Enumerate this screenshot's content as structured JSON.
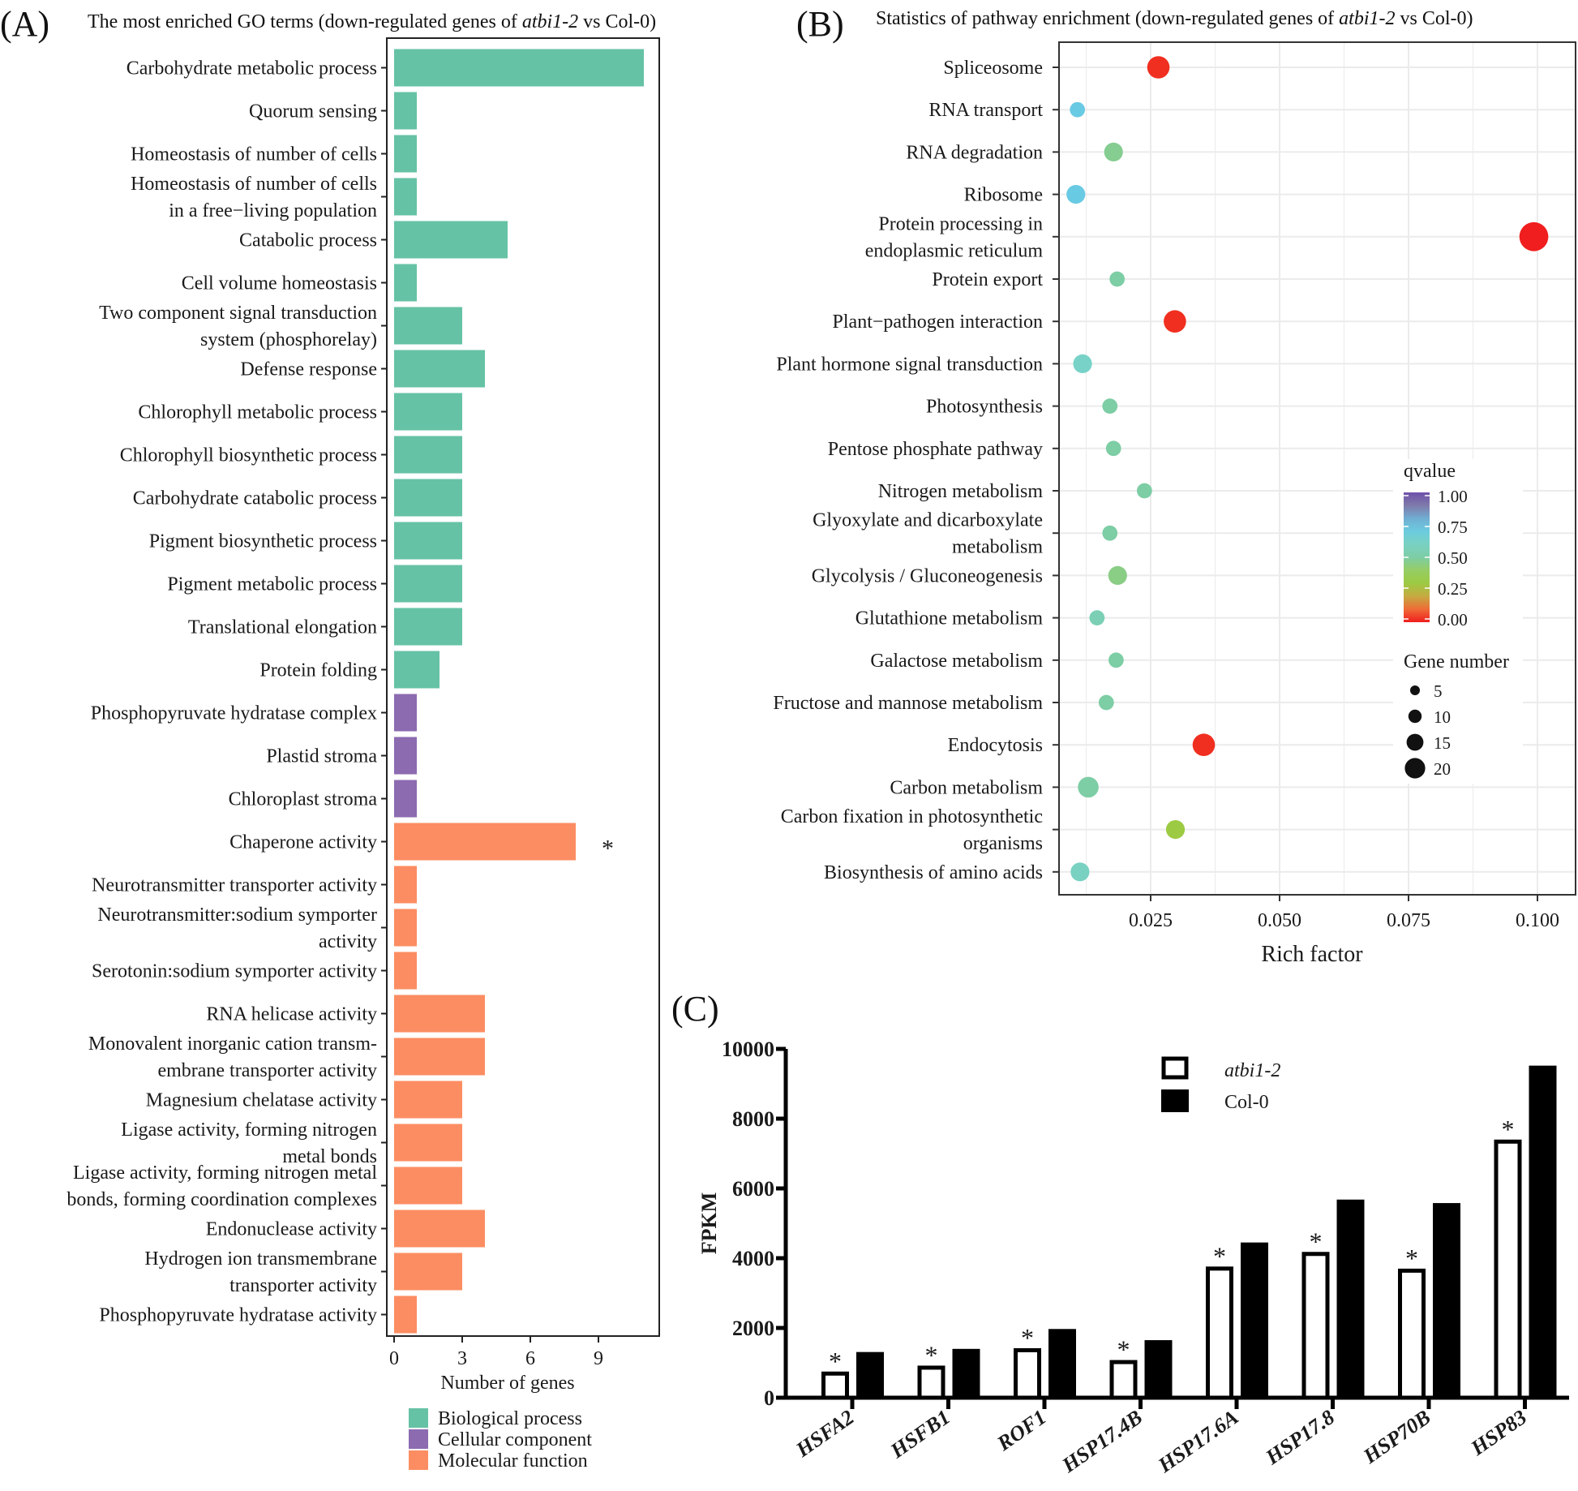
{
  "chart_data": [
    {
      "panel": "(A)",
      "type": "bar",
      "orientation": "horizontal",
      "title_prefix": "The most enriched GO terms (down-regulated genes of ",
      "title_italic": "atbi1-2",
      "title_suffix": " vs Col-0)",
      "xlabel": "Number of genes",
      "ylabel": "",
      "xlim": [
        0,
        11.5
      ],
      "xticks": [
        0,
        3,
        6,
        9
      ],
      "grid": false,
      "legend_position": "bottom",
      "legend": [
        {
          "name": "Biological process",
          "color": "#66c2a5"
        },
        {
          "name": "Cellular component",
          "color": "#8c6bb1"
        },
        {
          "name": "Molecular function",
          "color": "#fc8d62"
        }
      ],
      "categories": [
        {
          "label": [
            "Carbohydrate metabolic process"
          ],
          "value": 11,
          "group": 0
        },
        {
          "label": [
            "Quorum sensing"
          ],
          "value": 1,
          "group": 0
        },
        {
          "label": [
            "Homeostasis of number of cells"
          ],
          "value": 1,
          "group": 0
        },
        {
          "label": [
            "Homeostasis of number of cells",
            "in a free−living population"
          ],
          "value": 1,
          "group": 0
        },
        {
          "label": [
            "Catabolic process"
          ],
          "value": 5,
          "group": 0
        },
        {
          "label": [
            "Cell volume homeostasis"
          ],
          "value": 1,
          "group": 0
        },
        {
          "label": [
            "Two component signal transduction",
            "system (phosphorelay)"
          ],
          "value": 3,
          "group": 0
        },
        {
          "label": [
            "Defense response"
          ],
          "value": 4,
          "group": 0
        },
        {
          "label": [
            "Chlorophyll metabolic process"
          ],
          "value": 3,
          "group": 0
        },
        {
          "label": [
            "Chlorophyll biosynthetic process"
          ],
          "value": 3,
          "group": 0
        },
        {
          "label": [
            "Carbohydrate catabolic process"
          ],
          "value": 3,
          "group": 0
        },
        {
          "label": [
            "Pigment biosynthetic process"
          ],
          "value": 3,
          "group": 0
        },
        {
          "label": [
            "Pigment metabolic process"
          ],
          "value": 3,
          "group": 0
        },
        {
          "label": [
            "Translational elongation"
          ],
          "value": 3,
          "group": 0
        },
        {
          "label": [
            "Protein folding"
          ],
          "value": 2,
          "group": 0
        },
        {
          "label": [
            "Phosphopyruvate hydratase complex"
          ],
          "value": 1,
          "group": 1
        },
        {
          "label": [
            "Plastid stroma"
          ],
          "value": 1,
          "group": 1
        },
        {
          "label": [
            "Chloroplast stroma"
          ],
          "value": 1,
          "group": 1
        },
        {
          "label": [
            "Chaperone activity"
          ],
          "value": 8,
          "group": 2,
          "mark": "*"
        },
        {
          "label": [
            "Neurotransmitter transporter activity"
          ],
          "value": 1,
          "group": 2
        },
        {
          "label": [
            "Neurotransmitter:sodium symporter",
            "activity"
          ],
          "value": 1,
          "group": 2
        },
        {
          "label": [
            "Serotonin:sodium symporter activity"
          ],
          "value": 1,
          "group": 2
        },
        {
          "label": [
            "RNA helicase activity"
          ],
          "value": 4,
          "group": 2
        },
        {
          "label": [
            "Monovalent inorganic cation transm-",
            "embrane transporter activity"
          ],
          "value": 4,
          "group": 2
        },
        {
          "label": [
            "Magnesium chelatase activity"
          ],
          "value": 3,
          "group": 2
        },
        {
          "label": [
            "Ligase activity, forming nitrogen",
            "metal bonds"
          ],
          "value": 3,
          "group": 2
        },
        {
          "label": [
            "Ligase activity, forming nitrogen metal",
            "bonds, forming coordination complexes"
          ],
          "value": 3,
          "group": 2
        },
        {
          "label": [
            "Endonuclease activity"
          ],
          "value": 4,
          "group": 2
        },
        {
          "label": [
            "Hydrogen ion transmembrane",
            "transporter activity"
          ],
          "value": 3,
          "group": 2
        },
        {
          "label": [
            "Phosphopyruvate hydratase activity"
          ],
          "value": 1,
          "group": 2
        }
      ]
    },
    {
      "panel": "(B)",
      "type": "scatter",
      "title_prefix": "Statistics of pathway enrichment (down-regulated genes of ",
      "title_italic": "atbi1-2",
      "title_suffix": " vs Col-0)",
      "xlabel": "Rich factor",
      "ylabel": "",
      "xlim": [
        0.0075,
        0.1075
      ],
      "xticks": [
        0.025,
        0.05,
        0.075,
        0.1
      ],
      "xtick_labels": [
        "0.025",
        "0.050",
        "0.075",
        "0.100"
      ],
      "grid": true,
      "legend_position": "right",
      "color_legend": {
        "title": "qvalue",
        "ticks": [
          "1.00",
          "0.75",
          "0.50",
          "0.25",
          "0.00"
        ]
      },
      "size_legend": {
        "title": "Gene number",
        "values": [
          5,
          10,
          15,
          20
        ]
      },
      "points": [
        {
          "label": [
            "Spliceosome"
          ],
          "x": 0.0265,
          "qvalue": 0.02,
          "genes": 10
        },
        {
          "label": [
            "RNA transport"
          ],
          "x": 0.0108,
          "qvalue": 0.72,
          "genes": 3
        },
        {
          "label": [
            "RNA degradation"
          ],
          "x": 0.0178,
          "qvalue": 0.47,
          "genes": 6
        },
        {
          "label": [
            "Ribosome"
          ],
          "x": 0.0105,
          "qvalue": 0.72,
          "genes": 6
        },
        {
          "label": [
            "Protein processing in",
            "endoplasmic reticulum"
          ],
          "x": 0.0993,
          "qvalue": 0.0,
          "genes": 20
        },
        {
          "label": [
            "Protein export"
          ],
          "x": 0.0185,
          "qvalue": 0.5,
          "genes": 3
        },
        {
          "label": [
            "Plant−pathogen interaction"
          ],
          "x": 0.0297,
          "qvalue": 0.02,
          "genes": 10
        },
        {
          "label": [
            "Plant hormone signal transduction"
          ],
          "x": 0.0118,
          "qvalue": 0.62,
          "genes": 6
        },
        {
          "label": [
            "Photosynthesis"
          ],
          "x": 0.0171,
          "qvalue": 0.5,
          "genes": 3
        },
        {
          "label": [
            "Pentose phosphate pathway"
          ],
          "x": 0.0178,
          "qvalue": 0.5,
          "genes": 3
        },
        {
          "label": [
            "Nitrogen metabolism"
          ],
          "x": 0.0238,
          "qvalue": 0.5,
          "genes": 3
        },
        {
          "label": [
            "Glyoxylate and dicarboxylate",
            "metabolism"
          ],
          "x": 0.0171,
          "qvalue": 0.5,
          "genes": 3
        },
        {
          "label": [
            "Glycolysis / Gluconeogenesis"
          ],
          "x": 0.0186,
          "qvalue": 0.45,
          "genes": 6
        },
        {
          "label": [
            "Glutathione metabolism"
          ],
          "x": 0.0146,
          "qvalue": 0.55,
          "genes": 3
        },
        {
          "label": [
            "Galactose metabolism"
          ],
          "x": 0.0183,
          "qvalue": 0.5,
          "genes": 3
        },
        {
          "label": [
            "Fructose and mannose metabolism"
          ],
          "x": 0.0164,
          "qvalue": 0.5,
          "genes": 3
        },
        {
          "label": [
            "Endocytosis"
          ],
          "x": 0.0353,
          "qvalue": 0.02,
          "genes": 10
        },
        {
          "label": [
            "Carbon metabolism"
          ],
          "x": 0.0129,
          "qvalue": 0.5,
          "genes": 8
        },
        {
          "label": [
            "Carbon fixation in photosynthetic",
            "organisms"
          ],
          "x": 0.0298,
          "qvalue": 0.3,
          "genes": 6
        },
        {
          "label": [
            "Biosynthesis of amino acids"
          ],
          "x": 0.0113,
          "qvalue": 0.6,
          "genes": 6
        }
      ]
    },
    {
      "panel": "(C)",
      "type": "bar",
      "title": "",
      "xlabel": "",
      "ylabel": "FPKM",
      "ylim": [
        0,
        10000
      ],
      "yticks": [
        0,
        2000,
        4000,
        6000,
        8000,
        10000
      ],
      "grid": false,
      "legend_position": "top-right",
      "categories": [
        "HSFA2",
        "HSFB1",
        "ROF1",
        "HSP17.4B",
        "HSP17.6A",
        "HSP17.8",
        "HSP70B",
        "HSP83"
      ],
      "series": [
        {
          "name": "atbi1-2",
          "style": "open",
          "values": [
            750,
            920,
            1420,
            1080,
            3760,
            4180,
            3700,
            7400
          ],
          "significance": [
            "*",
            "*",
            "*",
            "*",
            "*",
            "*",
            "*",
            "*"
          ]
        },
        {
          "name": "Col-0",
          "style": "filled",
          "values": [
            1310,
            1400,
            1970,
            1650,
            4450,
            5680,
            5580,
            9520
          ]
        }
      ]
    }
  ]
}
